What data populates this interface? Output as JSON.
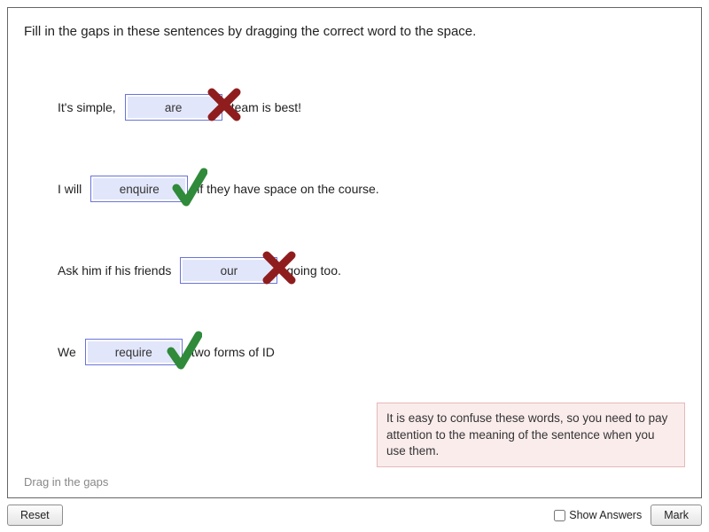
{
  "instruction": "Fill in the gaps in these sentences by dragging the correct word to the space.",
  "rows": [
    {
      "pre": "It's simple,",
      "placed": "are",
      "mark": "wrong",
      "post": "team is best!"
    },
    {
      "pre": "I will",
      "placed": "enquire",
      "mark": "correct",
      "post": "if they have space on the course."
    },
    {
      "pre": "Ask him if his friends",
      "placed": "our",
      "mark": "wrong",
      "post": "going too."
    },
    {
      "pre": "We",
      "placed": "require",
      "mark": "correct",
      "post": "two forms of ID"
    }
  ],
  "feedback": "It is easy to confuse these words, so you need to pay attention to the meaning of the sentence when you use them.",
  "hint": "Drag in the gaps",
  "toolbar": {
    "reset": "Reset",
    "show_answers": "Show Answers",
    "mark": "Mark"
  }
}
